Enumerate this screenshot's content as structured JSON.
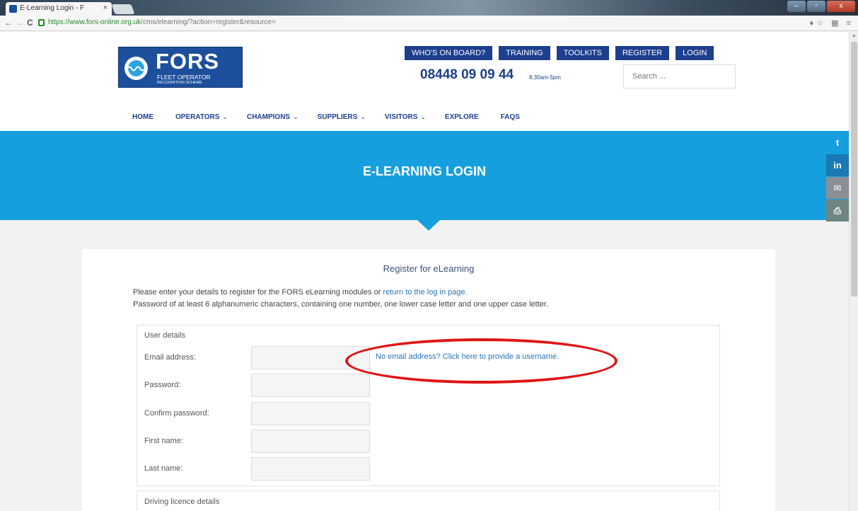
{
  "browser": {
    "tab_title": "E-Learning Login - F",
    "tab_close": "×",
    "url_secure": "https://www.fors-online.org.uk",
    "url_rest": "/cms/elearning/?action=register&resource=",
    "nav": {
      "back": "←",
      "forward": "→",
      "reload": "C"
    },
    "window_controls": {
      "minimize": "–",
      "maximize": "▫",
      "close": "x"
    },
    "toolbar_icons": "♦☆ ▦ ≡"
  },
  "header": {
    "logo": {
      "brand": "FORS",
      "sub1": "FLEET OPERATOR",
      "sub2": "RECOGNITION SCHEME"
    },
    "top_nav": [
      "WHO'S ON BOARD?",
      "TRAINING",
      "TOOLKITS",
      "REGISTER",
      "LOGIN"
    ],
    "phone": "08448 09 09 44",
    "hours": "8.30am-5pm",
    "search_placeholder": "Search ...",
    "main_nav": [
      {
        "label": "HOME",
        "caret": ""
      },
      {
        "label": "OPERATORS",
        "caret": "⌄"
      },
      {
        "label": "CHAMPIONS",
        "caret": "⌄"
      },
      {
        "label": "SUPPLIERS",
        "caret": "⌄"
      },
      {
        "label": "VISITORS",
        "caret": "⌄"
      },
      {
        "label": "EXPLORE",
        "caret": ""
      },
      {
        "label": "FAQS",
        "caret": ""
      }
    ]
  },
  "hero": {
    "title": "E-LEARNING LOGIN"
  },
  "social": [
    {
      "icon": "twitter-icon",
      "glyph": "t",
      "color": "#169fde"
    },
    {
      "icon": "linkedin-icon",
      "glyph": "in",
      "color": "#1a78b4"
    },
    {
      "icon": "email-icon",
      "glyph": "✉",
      "color": "#8a8f96"
    },
    {
      "icon": "print-icon",
      "glyph": "⎙",
      "color": "#6f8583"
    }
  ],
  "form": {
    "title": "Register for eLearning",
    "intro_1": "Please enter your details to register for the FORS eLearning modules or ",
    "intro_link": "return to the log in page.",
    "intro_2": "Password of at least 6 alphanumeric characters, containing one number, one lower case letter and one upper case letter.",
    "user_details_legend": "User details",
    "fields": [
      {
        "label": "Email address:",
        "value": ""
      },
      {
        "label": "Password:",
        "value": ""
      },
      {
        "label": "Confirm password:",
        "value": ""
      },
      {
        "label": "First name:",
        "value": ""
      },
      {
        "label": "Last name:",
        "value": ""
      }
    ],
    "no_email_link": "No email address? Click here to provide a username.",
    "driving_legend": "Driving licence details"
  },
  "colors": {
    "brand_blue": "#1d3f8e",
    "hero_blue": "#169fde",
    "link": "#2a74b8",
    "annotation_red": "#e01414"
  }
}
